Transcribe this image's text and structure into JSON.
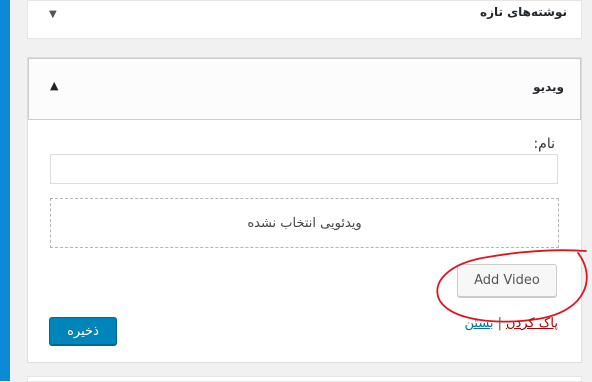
{
  "widgets": {
    "recent_posts_title": "نوشته‌های تازه",
    "video_title": "ویدیو"
  },
  "video_widget": {
    "name_label": "نام:",
    "name_value": "",
    "no_video_text": "ویدئویی انتخاب نشده",
    "add_video_label": "Add Video",
    "delete_label": "پاک کردن",
    "separator": "|",
    "close_label": "بستن",
    "save_label": "ذخیره"
  },
  "colors": {
    "primary_button": "#0085ba",
    "annotation_circle": "#e0141e",
    "link": "#0073aa",
    "delete_link": "#a00000"
  }
}
